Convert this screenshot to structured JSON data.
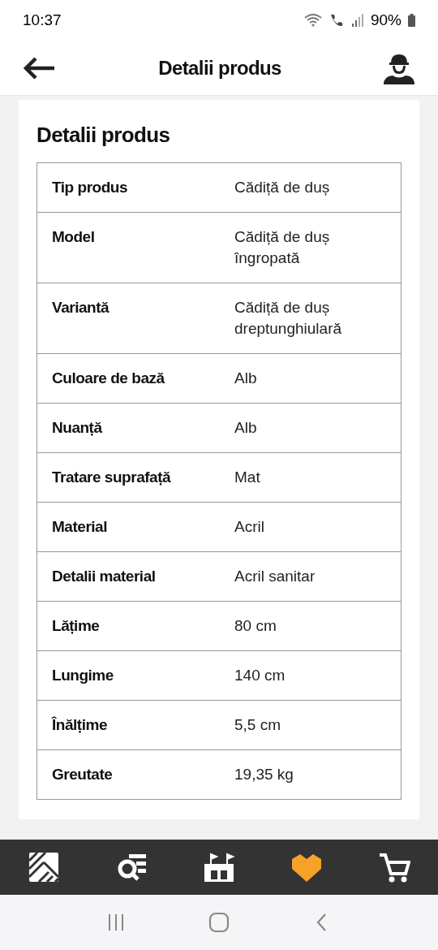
{
  "status_bar": {
    "time": "10:37",
    "battery": "90%"
  },
  "header": {
    "title": "Detalii produs"
  },
  "card": {
    "title": "Detalii produs",
    "rows": [
      {
        "label": "Tip produs",
        "value": "Cădiță de duș"
      },
      {
        "label": "Model",
        "value": "Cădiță de duș îngropată"
      },
      {
        "label": "Variantă",
        "value": "Cădiță de duș dreptunghiulară"
      },
      {
        "label": "Culoare de bază",
        "value": "Alb"
      },
      {
        "label": "Nuanță",
        "value": "Alb"
      },
      {
        "label": "Tratare suprafață",
        "value": "Mat"
      },
      {
        "label": "Material",
        "value": "Acril"
      },
      {
        "label": "Detalii material",
        "value": "Acril sanitar"
      },
      {
        "label": "Lățime",
        "value": "80 cm"
      },
      {
        "label": "Lungime",
        "value": "140 cm"
      },
      {
        "label": "Înălțime",
        "value": "5,5 cm"
      },
      {
        "label": "Greutate",
        "value": "19,35 kg"
      }
    ]
  },
  "bottom_nav": [
    {
      "kind": "home",
      "selected": false
    },
    {
      "kind": "search",
      "selected": false
    },
    {
      "kind": "store",
      "selected": false
    },
    {
      "kind": "favorites",
      "selected": true
    },
    {
      "kind": "cart",
      "selected": false
    }
  ]
}
